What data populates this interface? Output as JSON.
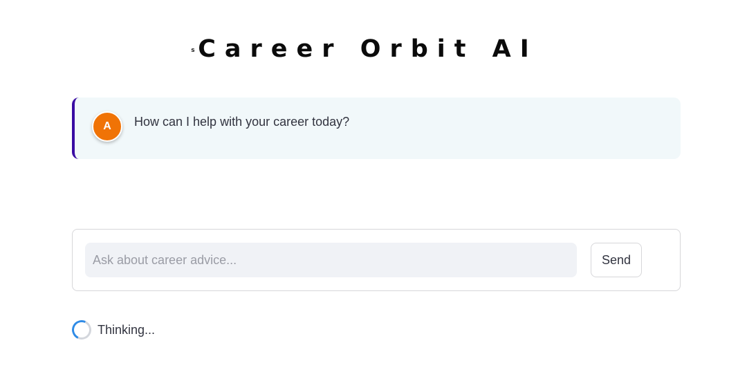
{
  "app": {
    "title": "Career Orbit AI",
    "title_mark": "s"
  },
  "chat": {
    "messages": [
      {
        "role": "assistant",
        "avatar_letter": "A",
        "text": "How can I help with your career today?"
      }
    ]
  },
  "input": {
    "placeholder": "Ask about career advice...",
    "value": "",
    "send_label": "Send"
  },
  "status": {
    "text": "Thinking...",
    "icon": "spinner-icon"
  },
  "colors": {
    "accent_border": "#3a0ca3",
    "avatar_bg": "#f07306",
    "message_bg": "#f1f8fa",
    "spinner": "#2f8be6"
  }
}
